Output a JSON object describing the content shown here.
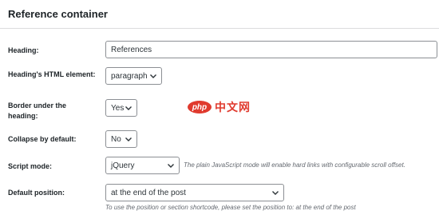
{
  "panel": {
    "title": "Reference container"
  },
  "fields": {
    "heading": {
      "label": "Heading:",
      "value": "References"
    },
    "heading_element": {
      "label": "Heading's HTML element:",
      "value": "paragraph"
    },
    "border": {
      "label": "Border under the heading:",
      "value": "Yes"
    },
    "collapse": {
      "label": "Collapse by default:",
      "value": "No"
    },
    "script_mode": {
      "label": "Script mode:",
      "value": "jQuery",
      "hint": "The plain JavaScript mode will enable hard links with configurable scroll offset."
    },
    "default_position": {
      "label": "Default position:",
      "value": "at the end of the post",
      "hint": "To use the position or section shortcode, please set the position to: at the end of the post"
    }
  },
  "watermark": {
    "badge": "php",
    "text": "中文网"
  },
  "icons": {
    "select_arrow": "chevron-down-icon"
  },
  "colors": {
    "border": "#8c8f94",
    "hint": "#646970",
    "watermark": "#e03a2e"
  }
}
